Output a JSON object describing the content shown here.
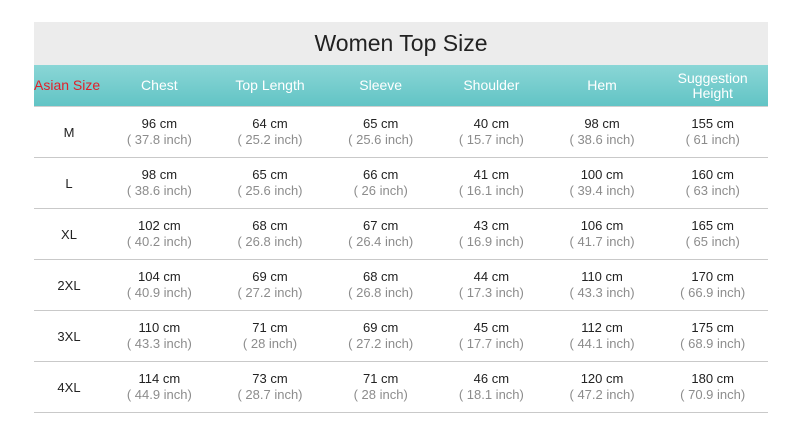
{
  "title": "Women Top Size",
  "header": {
    "size": "Asian Size",
    "columns": [
      "Chest",
      "Top Length",
      "Sleeve",
      "Shoulder",
      "Hem",
      "Suggestion Height"
    ]
  },
  "rows": [
    {
      "size": "M",
      "cells": [
        {
          "cm": "96 cm",
          "inch": "( 37.8 inch)"
        },
        {
          "cm": "64 cm",
          "inch": "( 25.2 inch)"
        },
        {
          "cm": "65 cm",
          "inch": "( 25.6 inch)"
        },
        {
          "cm": "40 cm",
          "inch": "( 15.7 inch)"
        },
        {
          "cm": "98 cm",
          "inch": "( 38.6 inch)"
        },
        {
          "cm": "155 cm",
          "inch": "( 61 inch)"
        }
      ]
    },
    {
      "size": "L",
      "cells": [
        {
          "cm": "98 cm",
          "inch": "( 38.6 inch)"
        },
        {
          "cm": "65 cm",
          "inch": "( 25.6 inch)"
        },
        {
          "cm": "66 cm",
          "inch": "( 26 inch)"
        },
        {
          "cm": "41 cm",
          "inch": "( 16.1 inch)"
        },
        {
          "cm": "100 cm",
          "inch": "( 39.4 inch)"
        },
        {
          "cm": "160 cm",
          "inch": "( 63 inch)"
        }
      ]
    },
    {
      "size": "XL",
      "cells": [
        {
          "cm": "102 cm",
          "inch": "( 40.2 inch)"
        },
        {
          "cm": "68 cm",
          "inch": "( 26.8 inch)"
        },
        {
          "cm": "67 cm",
          "inch": "( 26.4 inch)"
        },
        {
          "cm": "43 cm",
          "inch": "( 16.9 inch)"
        },
        {
          "cm": "106 cm",
          "inch": "( 41.7 inch)"
        },
        {
          "cm": "165 cm",
          "inch": "( 65 inch)"
        }
      ]
    },
    {
      "size": "2XL",
      "cells": [
        {
          "cm": "104 cm",
          "inch": "( 40.9 inch)"
        },
        {
          "cm": "69 cm",
          "inch": "( 27.2 inch)"
        },
        {
          "cm": "68 cm",
          "inch": "( 26.8 inch)"
        },
        {
          "cm": "44 cm",
          "inch": "( 17.3 inch)"
        },
        {
          "cm": "110 cm",
          "inch": "( 43.3 inch)"
        },
        {
          "cm": "170 cm",
          "inch": "( 66.9 inch)"
        }
      ]
    },
    {
      "size": "3XL",
      "cells": [
        {
          "cm": "110 cm",
          "inch": "( 43.3 inch)"
        },
        {
          "cm": "71 cm",
          "inch": "( 28 inch)"
        },
        {
          "cm": "69 cm",
          "inch": "( 27.2 inch)"
        },
        {
          "cm": "45 cm",
          "inch": "( 17.7 inch)"
        },
        {
          "cm": "112 cm",
          "inch": "( 44.1 inch)"
        },
        {
          "cm": "175 cm",
          "inch": "( 68.9 inch)"
        }
      ]
    },
    {
      "size": "4XL",
      "cells": [
        {
          "cm": "114 cm",
          "inch": "( 44.9 inch)"
        },
        {
          "cm": "73 cm",
          "inch": "( 28.7 inch)"
        },
        {
          "cm": "71 cm",
          "inch": "( 28 inch)"
        },
        {
          "cm": "46 cm",
          "inch": "( 18.1 inch)"
        },
        {
          "cm": "120 cm",
          "inch": "( 47.2 inch)"
        },
        {
          "cm": "180 cm",
          "inch": "( 70.9 inch)"
        }
      ]
    }
  ],
  "colors": {
    "title_bg": "#ececec",
    "header_bg": "#6fc9ca",
    "header_text": "#ffffff",
    "size_header_text": "#e0202a",
    "inch_text": "#8c8c8c",
    "row_divider": "#c9c9c9"
  }
}
